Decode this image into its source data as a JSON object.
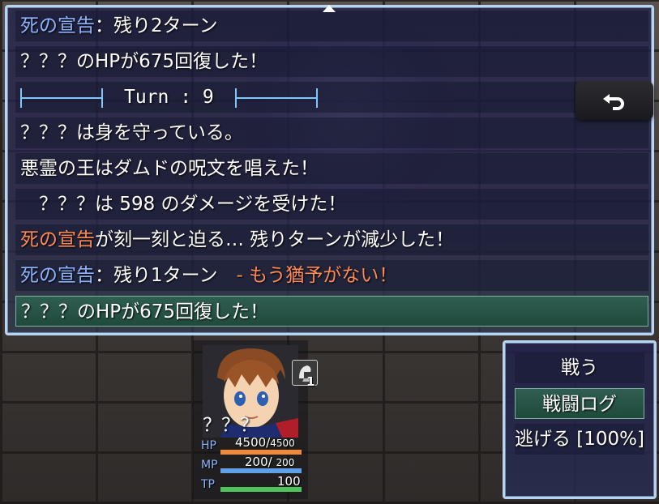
{
  "log": {
    "lines": [
      {
        "parts": [
          {
            "text": "死の宣告",
            "color": "blue"
          },
          {
            "text": "：残り2ターン"
          }
        ]
      },
      {
        "parts": [
          {
            "text": "？？？のHPが675回復した！"
          }
        ]
      },
      {
        "turn_label": "Turn : 9"
      },
      {
        "parts": [
          {
            "text": "？？？は身を守っている。"
          }
        ]
      },
      {
        "parts": [
          {
            "text": "悪霊の王はダムドの呪文を唱えた！"
          }
        ]
      },
      {
        "parts": [
          {
            "text": "　？？？は 598 のダメージを受けた！"
          }
        ]
      },
      {
        "parts": [
          {
            "text": "死の宣告",
            "color": "orange"
          },
          {
            "text": "が刻一刻と迫る… 残りターンが減少した！"
          }
        ]
      },
      {
        "parts": [
          {
            "text": "死の宣告",
            "color": "blue"
          },
          {
            "text": "：残り1ターン　"
          },
          {
            "text": "- もう猶予がない！",
            "color": "orange"
          }
        ]
      },
      {
        "parts": [
          {
            "text": "？？？のHPが675回復した！"
          }
        ],
        "selected": true
      }
    ]
  },
  "actor": {
    "name": "？？？",
    "state_count": "1",
    "hp": {
      "label": "HP",
      "current": "4500",
      "max": "4500",
      "fraction": 1.0
    },
    "mp": {
      "label": "MP",
      "current": "200",
      "max": "200",
      "fraction": 1.0
    },
    "tp": {
      "label": "TP",
      "value": "100",
      "fraction": 1.0
    }
  },
  "commands": [
    {
      "label": "戦う"
    },
    {
      "label": "戦闘ログ",
      "selected": true
    },
    {
      "label": "逃げる [100%]"
    }
  ],
  "colors": {
    "blue": "#8fb4ff",
    "orange": "#ff8a55",
    "hp_gauge": "#f08a3a",
    "mp_gauge": "#5fa0e8",
    "tp_gauge": "#4ec45a"
  },
  "icons": [
    "scroll-up-icon",
    "back-arrow-icon",
    "state-icon"
  ]
}
